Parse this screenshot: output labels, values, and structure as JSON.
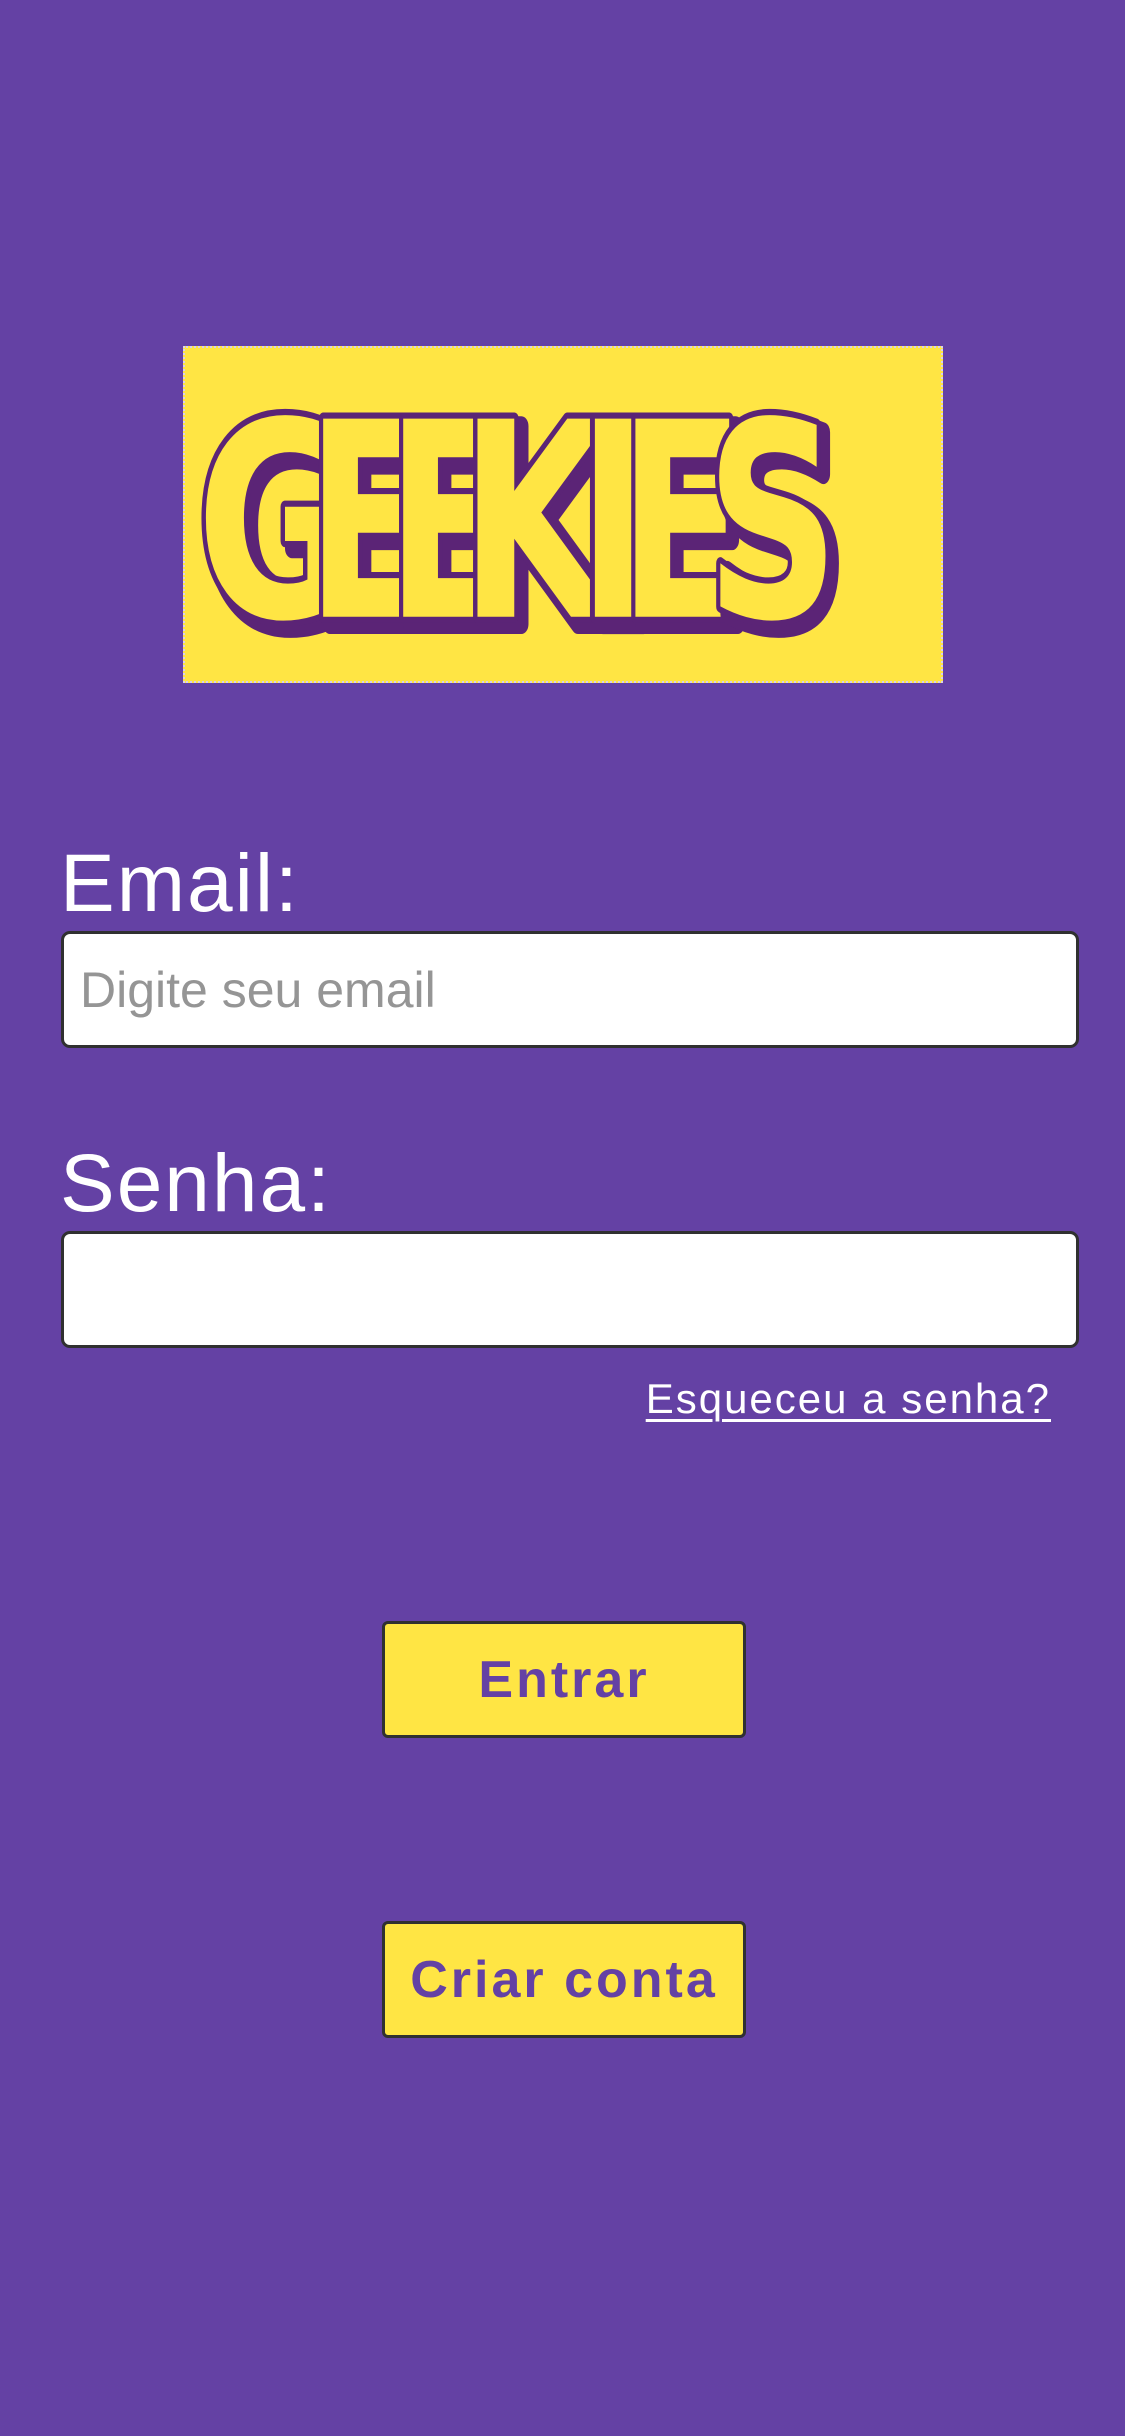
{
  "logo": {
    "text": "GEEKIES",
    "letters": [
      "G",
      "E",
      "E",
      "K",
      "I",
      "E",
      "S"
    ],
    "background_color": "#ffe544",
    "letter_color": "#5b2476"
  },
  "login_form": {
    "email_label": "Email:",
    "email_placeholder": "Digite seu email",
    "email_value": "",
    "password_label": "Senha:",
    "password_value": "",
    "forgot_password_link": "Esqueceu a senha?"
  },
  "actions": {
    "login_button": "Entrar",
    "create_account_button": "Criar conta"
  },
  "colors": {
    "background": "#6441a4",
    "accent": "#ffe544",
    "text": "#ffffff"
  }
}
